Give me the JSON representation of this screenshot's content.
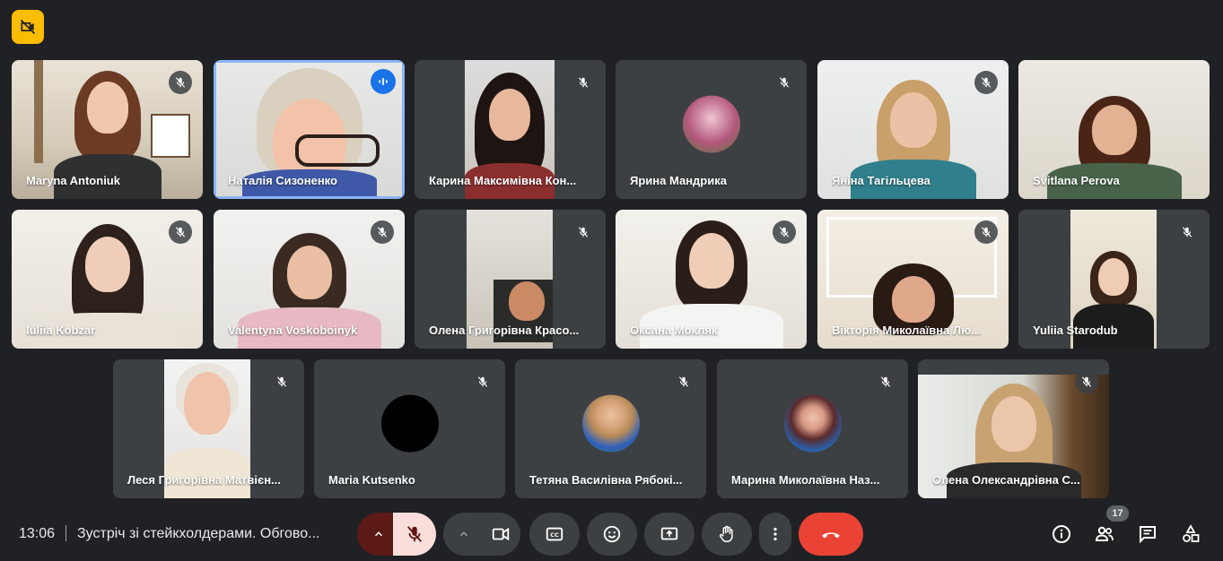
{
  "participants": [
    {
      "name": "Maryna Antoniuk",
      "muted": true
    },
    {
      "name": "Наталія Сизоненко",
      "muted": false,
      "speaking": true
    },
    {
      "name": "Карина Максимівна Кон...",
      "muted": true
    },
    {
      "name": "Ярина Мандрика",
      "muted": true
    },
    {
      "name": "Яніна Тагільцева",
      "muted": true
    },
    {
      "name": "Svitlana Perova",
      "muted": true
    },
    {
      "name": "Iuliia Kobzar",
      "muted": true
    },
    {
      "name": "Valentyna Voskoboinyk",
      "muted": true
    },
    {
      "name": "Олена Григорівна Красо...",
      "muted": true
    },
    {
      "name": "Оксана Мокляк",
      "muted": true
    },
    {
      "name": "Вікторія Миколаївна Лю...",
      "muted": true
    },
    {
      "name": "Yuliia Starodub",
      "muted": true
    },
    {
      "name": "Леся Григорівна Матвієн...",
      "muted": true
    },
    {
      "name": "Maria Kutsenko",
      "muted": true
    },
    {
      "name": "Тетяна Василівна Рябокі...",
      "muted": true
    },
    {
      "name": "Марина Миколаївна Наз...",
      "muted": true
    },
    {
      "name": "Олена Олександрівна С...",
      "muted": true
    }
  ],
  "meeting": {
    "time": "13:06",
    "title": "Зустріч зі стейкхолдерами. Обгово...",
    "participant_count": "17"
  },
  "icons": {
    "top_badge": "captions-off-icon",
    "colors": {
      "accent": "#8ab4f8",
      "end_call": "#ea4335",
      "mic_off_active": "#f9dedc",
      "badge": "#fbbc04"
    }
  }
}
